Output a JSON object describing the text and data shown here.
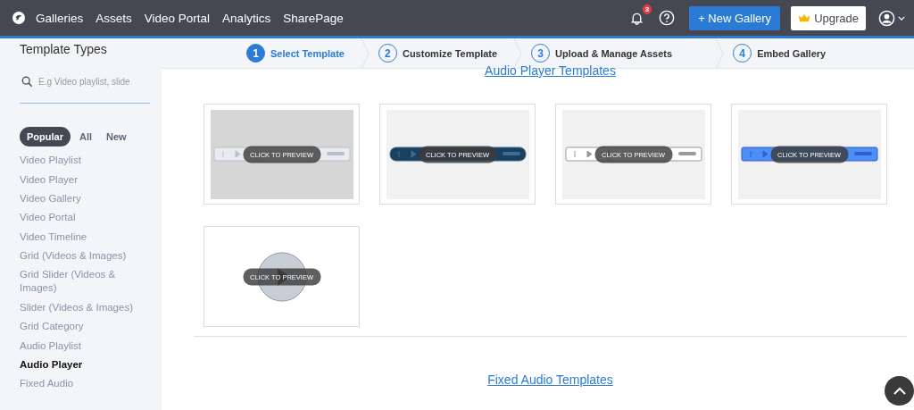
{
  "nav": {
    "links": [
      "Galleries",
      "Assets",
      "Video Portal",
      "Analytics",
      "SharePage"
    ],
    "notification_count": "3",
    "new_button": "+ New Gallery",
    "upgrade_button": "Upgrade"
  },
  "sidebar": {
    "title": "Template Types",
    "search": {
      "placeholder": "E.g Video playlist, slide"
    },
    "filters": [
      {
        "label": "Popular",
        "selected": true
      },
      {
        "label": "All",
        "selected": false
      },
      {
        "label": "New",
        "selected": false
      }
    ],
    "items": [
      {
        "label": "Video Playlist",
        "selected": false
      },
      {
        "label": "Video Player",
        "selected": false
      },
      {
        "label": "Video Gallery",
        "selected": false
      },
      {
        "label": "Video Portal",
        "selected": false
      },
      {
        "label": "Video Timeline",
        "selected": false
      },
      {
        "label": "Grid (Videos & Images)",
        "selected": false
      },
      {
        "label": "Grid Slider (Videos & Images)",
        "selected": false
      },
      {
        "label": "Slider (Videos & Images)",
        "selected": false
      },
      {
        "label": "Grid Category",
        "selected": false
      },
      {
        "label": "Audio Playlist",
        "selected": false
      },
      {
        "label": "Audio Player",
        "selected": true
      },
      {
        "label": "Fixed Audio",
        "selected": false
      }
    ]
  },
  "steps": [
    {
      "number": "1",
      "label": "Select Template",
      "selected": true
    },
    {
      "number": "2",
      "label": "Customize Template",
      "selected": false
    },
    {
      "number": "3",
      "label": "Upload & Manage Assets",
      "selected": false
    },
    {
      "number": "4",
      "label": "Embed Gallery",
      "selected": false
    }
  ],
  "sections": [
    {
      "title": "Audio Player Templates",
      "templates": [
        {
          "kind": "silver",
          "overlay": "CLICK TO PREVIEW"
        },
        {
          "kind": "navy",
          "overlay": "CLICK TO PREVIEW"
        },
        {
          "kind": "outline",
          "overlay": "CLICK TO PREVIEW"
        },
        {
          "kind": "blue",
          "overlay": "CLICK TO PREVIEW"
        },
        {
          "kind": "round",
          "overlay": "CLICK TO PREVIEW"
        }
      ]
    },
    {
      "title": "Fixed Audio Templates"
    }
  ]
}
